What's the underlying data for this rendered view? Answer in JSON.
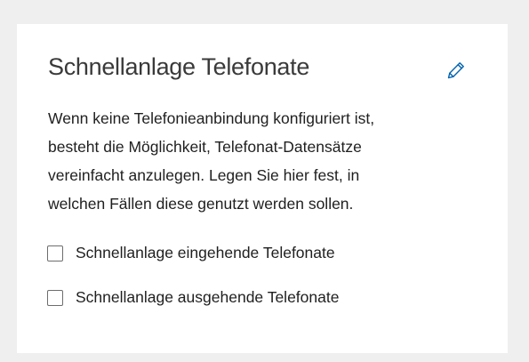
{
  "section": {
    "title": "Schnellanlage Telefonate",
    "edit_icon": "pencil-icon",
    "description_lines": [
      "Wenn keine Telefonieanbindung konfiguriert ist,",
      "besteht die Möglichkeit, Telefonat-Datensätze",
      "vereinfacht anzulegen. Legen Sie hier fest, in",
      "welchen Fällen diese genutzt werden sollen."
    ],
    "options": [
      {
        "label": "Schnellanlage eingehende Telefonate",
        "checked": false
      },
      {
        "label": "Schnellanlage ausgehende Telefonate",
        "checked": false
      }
    ]
  },
  "colors": {
    "background": "#efefef",
    "card": "#ffffff",
    "accent": "#0063b1",
    "text": "#1f1f1f"
  }
}
